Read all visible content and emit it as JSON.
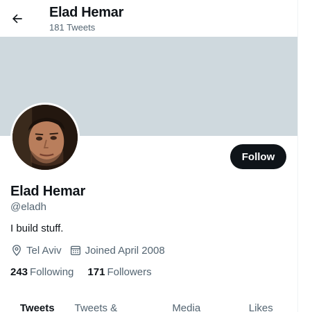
{
  "header": {
    "back_icon": "arrow-left-icon",
    "name": "Elad Hemar",
    "tweet_count": "181 Tweets"
  },
  "profile": {
    "name": "Elad Hemar",
    "handle": "@eladh",
    "bio": "I build stuff.",
    "location_icon": "location-pin-icon",
    "location": "Tel Aviv",
    "joined_icon": "calendar-icon",
    "joined": "Joined April 2008",
    "follow_label": "Follow"
  },
  "stats": {
    "following_count": "243",
    "following_label": "Following",
    "followers_count": "171",
    "followers_label": "Followers"
  },
  "tabs": [
    {
      "label": "Tweets",
      "active": true
    },
    {
      "label": "Tweets & replies",
      "active": false
    },
    {
      "label": "Media",
      "active": false
    },
    {
      "label": "Likes",
      "active": false
    }
  ],
  "colors": {
    "banner": "#cfd9de",
    "follow_button": "#0f1419",
    "secondary_text": "#536471"
  }
}
